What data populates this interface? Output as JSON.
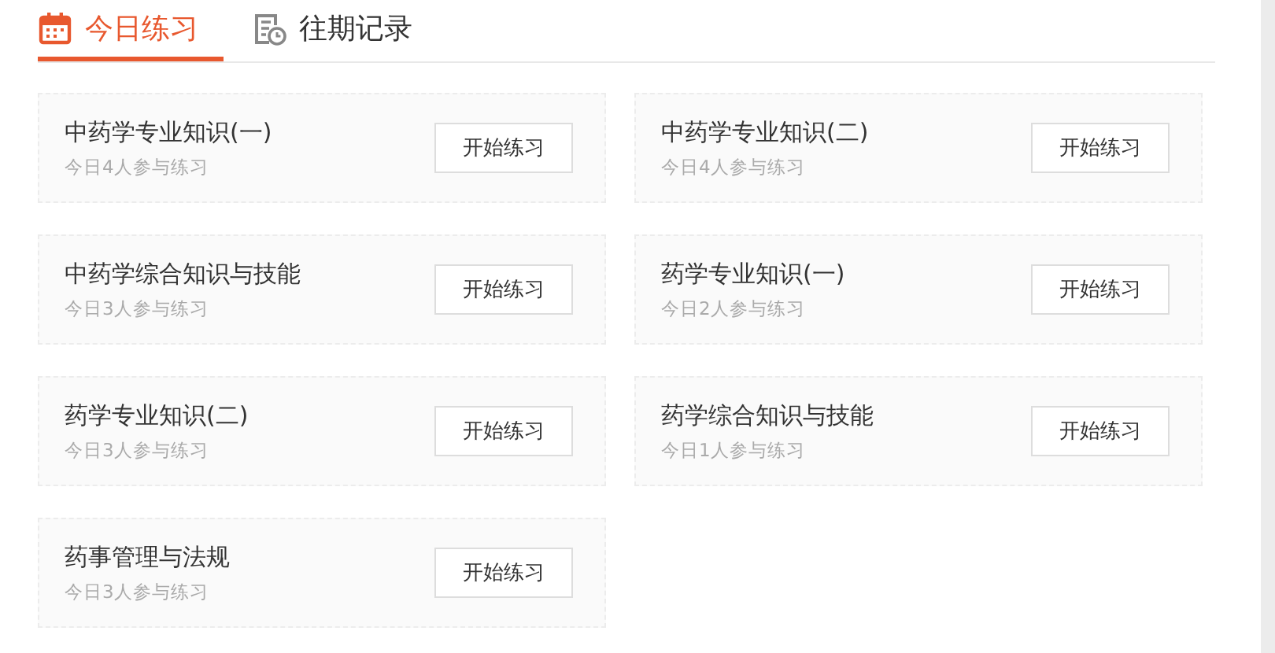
{
  "tabs": [
    {
      "label": "今日练习",
      "kind": "today",
      "selected": true
    },
    {
      "label": "往期记录",
      "kind": "history",
      "selected": false
    }
  ],
  "cards": [
    {
      "title": "中药学专业知识(一)",
      "participants": "今日4人参与练习",
      "button": "开始练习"
    },
    {
      "title": "中药学专业知识(二)",
      "participants": "今日4人参与练习",
      "button": "开始练习"
    },
    {
      "title": "中药学综合知识与技能",
      "participants": "今日3人参与练习",
      "button": "开始练习"
    },
    {
      "title": "药学专业知识(一)",
      "participants": "今日2人参与练习",
      "button": "开始练习"
    },
    {
      "title": "药学专业知识(二)",
      "participants": "今日3人参与练习",
      "button": "开始练习"
    },
    {
      "title": "药学综合知识与技能",
      "participants": "今日1人参与练习",
      "button": "开始练习"
    },
    {
      "title": "药事管理与法规",
      "participants": "今日3人参与练习",
      "button": "开始练习"
    }
  ]
}
